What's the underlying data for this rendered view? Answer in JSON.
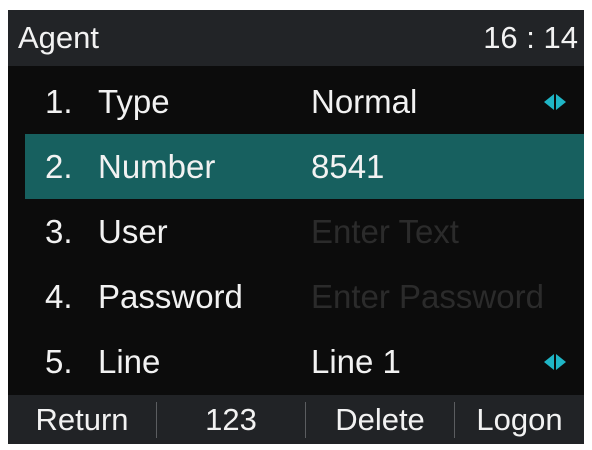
{
  "header": {
    "title": "Agent",
    "time": "16 : 14"
  },
  "form": {
    "rows": [
      {
        "num": "1.",
        "label": "Type",
        "value": "Normal",
        "arrows": true
      },
      {
        "num": "2.",
        "label": "Number",
        "value": "8541",
        "selected": true
      },
      {
        "num": "3.",
        "label": "User",
        "placeholder": "Enter Text"
      },
      {
        "num": "4.",
        "label": "Password",
        "placeholder": "Enter Password"
      },
      {
        "num": "5.",
        "label": "Line",
        "value": "Line 1",
        "arrows": true
      }
    ]
  },
  "softkeys": [
    "Return",
    "123",
    "Delete",
    "Logon"
  ],
  "colors": {
    "highlight": "#17605f",
    "arrow": "#1fb6c6",
    "background": "#0c0c0c"
  }
}
